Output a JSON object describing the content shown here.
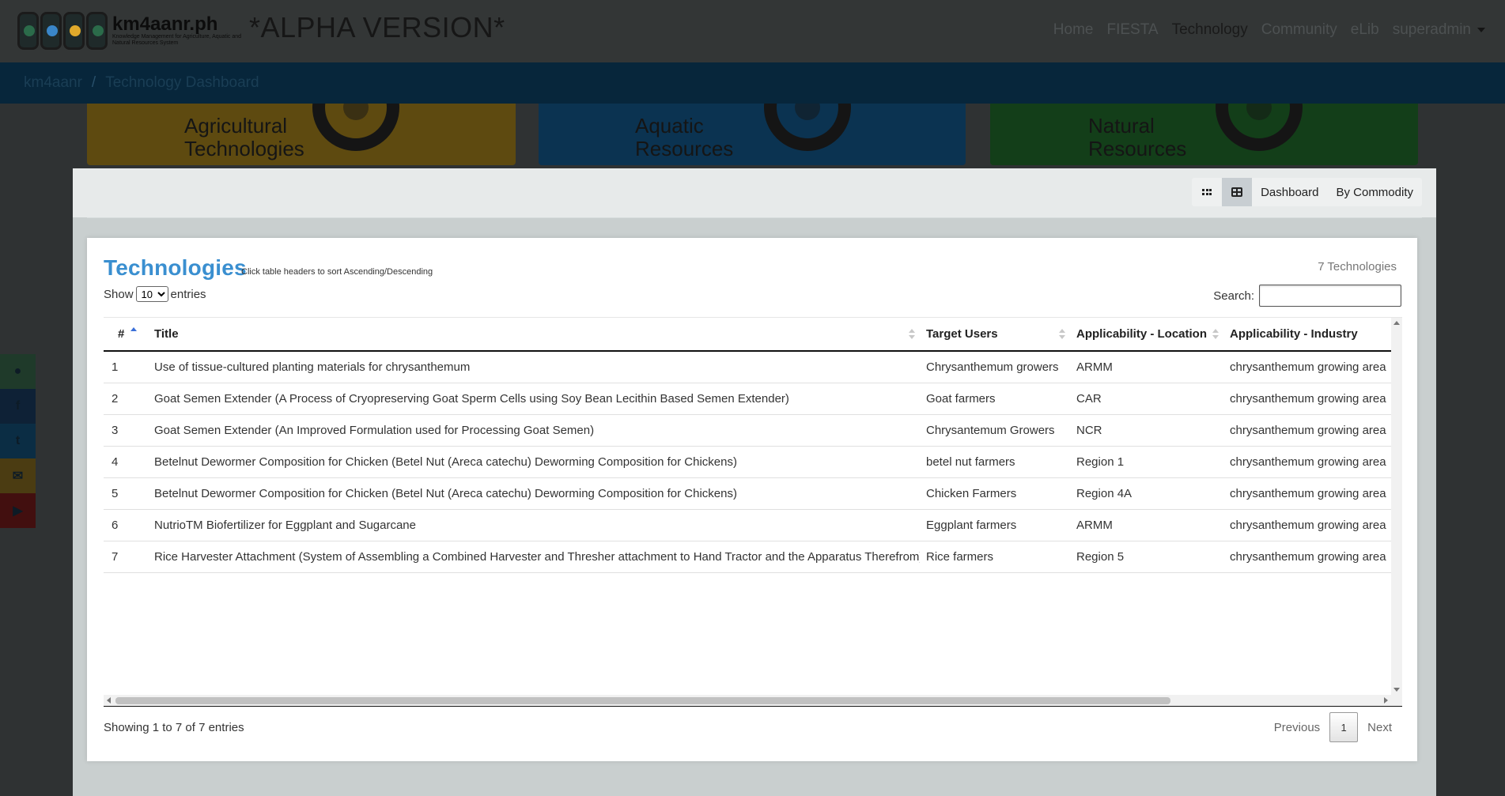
{
  "brand": {
    "name": "km4aanr.ph",
    "subtitle": "Knowledge Management for Agriculture, Aquatic and Natural Resources System",
    "alpha": "*ALPHA VERSION*"
  },
  "nav": {
    "items": [
      "Home",
      "FIESTA",
      "Technology",
      "Community",
      "eLib"
    ],
    "active": "Technology",
    "user": "superadmin"
  },
  "breadcrumb": [
    "km4aanr",
    "Technology Dashboard"
  ],
  "hero": {
    "agri": [
      "Agricultural",
      "Technologies"
    ],
    "aqua": [
      "Aquatic",
      "Resources"
    ],
    "nat": [
      "Natural",
      "Resources"
    ]
  },
  "view_toggle": {
    "dashboard": "Dashboard",
    "by_commodity": "By Commodity"
  },
  "card": {
    "title": "Technologies",
    "hint": "Click table headers to sort Ascending/Descending",
    "count": "7 Technologies",
    "show": "Show",
    "entries": "entries",
    "page_length": "10",
    "search_label": "Search:",
    "search_value": ""
  },
  "table": {
    "headers": [
      "#",
      "Title",
      "Target Users",
      "Applicability - Location",
      "Applicability - Industry"
    ],
    "rows": [
      {
        "num": "1",
        "title": "Use of tissue-cultured planting materials for chrysanthemum",
        "users": "Chrysanthemum growers",
        "location": "ARMM",
        "industry": "chrysanthemum growing area"
      },
      {
        "num": "2",
        "title": "Goat Semen Extender (A Process of Cryopreserving Goat Sperm Cells using Soy Bean Lecithin Based Semen Extender)",
        "users": "Goat farmers",
        "location": "CAR",
        "industry": "chrysanthemum growing area"
      },
      {
        "num": "3",
        "title": "Goat Semen Extender (An Improved Formulation used for Processing Goat Semen)",
        "users": "Chrysantemum Growers",
        "location": "NCR",
        "industry": "chrysanthemum growing area"
      },
      {
        "num": "4",
        "title": "Betelnut Dewormer Composition for Chicken (Betel Nut (Areca catechu) Deworming Composition for Chickens)",
        "users": "betel nut farmers",
        "location": "Region 1",
        "industry": "chrysanthemum growing area"
      },
      {
        "num": "5",
        "title": "Betelnut Dewormer Composition for Chicken (Betel Nut (Areca catechu) Deworming Composition for Chickens)",
        "users": "Chicken Farmers",
        "location": "Region 4A",
        "industry": "chrysanthemum growing area"
      },
      {
        "num": "6",
        "title": "NutrioTM Biofertilizer for Eggplant and Sugarcane",
        "users": "Eggplant farmers",
        "location": "ARMM",
        "industry": "chrysanthemum growing area"
      },
      {
        "num": "7",
        "title": "Rice Harvester Attachment (System of Assembling a Combined Harvester and Thresher attachment to Hand Tractor and the Apparatus Therefrom)",
        "users": "Rice farmers",
        "location": "Region 5",
        "industry": "chrysanthemum growing area"
      }
    ]
  },
  "footer": {
    "info": "Showing 1 to 7 of 7 entries",
    "previous": "Previous",
    "page": "1",
    "next": "Next"
  }
}
